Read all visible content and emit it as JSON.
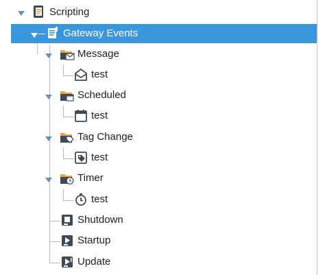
{
  "tree": {
    "scripting": {
      "label": "Scripting",
      "icon": "script-doc-icon"
    },
    "gateway_events": {
      "label": "Gateway Events",
      "icon": "gateway-events-icon"
    },
    "message": {
      "label": "Message",
      "icon": "folder-message-icon",
      "child": {
        "label": "test",
        "icon": "envelope-icon"
      }
    },
    "scheduled": {
      "label": "Scheduled",
      "icon": "folder-scheduled-icon",
      "child": {
        "label": "test",
        "icon": "calendar-icon"
      }
    },
    "tag_change": {
      "label": "Tag Change",
      "icon": "folder-tag-icon",
      "child": {
        "label": "test",
        "icon": "tag-icon"
      }
    },
    "timer": {
      "label": "Timer",
      "icon": "folder-timer-icon",
      "child": {
        "label": "test",
        "icon": "stopwatch-icon"
      }
    },
    "shutdown": {
      "label": "Shutdown",
      "icon": "shutdown-script-icon"
    },
    "startup": {
      "label": "Startup",
      "icon": "startup-script-icon"
    },
    "update": {
      "label": "Update",
      "icon": "update-script-icon"
    }
  },
  "colors": {
    "selection": "#3a97db",
    "folder_orange": "#f2a34a",
    "icon_dark": "#3f4a56",
    "toggle": "#6b8fb0"
  }
}
